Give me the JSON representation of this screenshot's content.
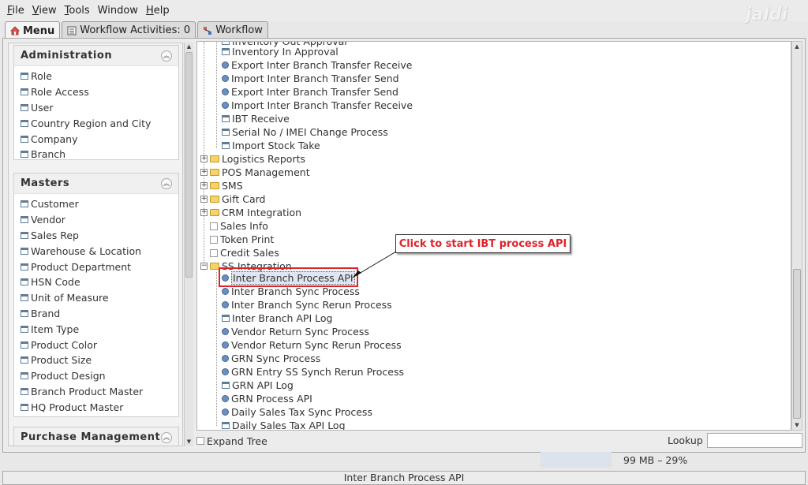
{
  "menubar": {
    "items": [
      {
        "label": "File",
        "mnemonic": "F",
        "rest": "ile"
      },
      {
        "label": "View",
        "mnemonic": "V",
        "rest": "iew"
      },
      {
        "label": "Tools",
        "mnemonic": "T",
        "rest": "ools"
      },
      {
        "label": "Window",
        "mnemonic": "",
        "rest": "Window"
      },
      {
        "label": "Help",
        "mnemonic": "H",
        "rest": "elp"
      }
    ],
    "brand": "jaldi"
  },
  "tabs": [
    {
      "label": "Menu",
      "icon": "home-icon"
    },
    {
      "label": "Workflow Activities: 0",
      "icon": "activities-icon"
    },
    {
      "label": "Workflow",
      "icon": "workflow-icon"
    }
  ],
  "sidebar": {
    "sections": [
      {
        "title": "Administration",
        "items": [
          "Role",
          "Role Access",
          "User",
          "Country Region and City",
          "Company",
          "Branch"
        ]
      },
      {
        "title": "Masters",
        "items": [
          "Customer",
          "Vendor",
          "Sales Rep",
          "Warehouse & Location",
          "Product Department",
          "HSN Code",
          "Unit of Measure",
          "Brand",
          "Item Type",
          "Product Color",
          "Product Size",
          "Product Design",
          "Branch Product Master",
          "HQ Product Master"
        ]
      },
      {
        "title": "Purchase Management",
        "items": []
      }
    ]
  },
  "tree": {
    "nodes": [
      {
        "label": "Inventory Out Approval",
        "icon": "window-icon"
      },
      {
        "label": "Inventory In Approval",
        "icon": "window-icon"
      },
      {
        "label": "Export Inter Branch Transfer Receive",
        "icon": "process-icon"
      },
      {
        "label": "Import Inter Branch Transfer Send",
        "icon": "process-icon"
      },
      {
        "label": "Export Inter Branch Transfer Send",
        "icon": "process-icon"
      },
      {
        "label": "Import Inter Branch Transfer Receive",
        "icon": "process-icon"
      },
      {
        "label": "IBT Receive",
        "icon": "window-icon"
      },
      {
        "label": "Serial No / IMEI Change Process",
        "icon": "window-icon"
      },
      {
        "label": "Import Stock Take",
        "icon": "window-icon"
      },
      {
        "label": "Logistics Reports",
        "icon": "folder-icon"
      },
      {
        "label": "POS Management",
        "icon": "folder-icon"
      },
      {
        "label": "SMS",
        "icon": "folder-icon"
      },
      {
        "label": "Gift Card",
        "icon": "folder-icon"
      },
      {
        "label": "CRM Integration",
        "icon": "folder-icon"
      },
      {
        "label": "Sales Info",
        "icon": "report-icon"
      },
      {
        "label": "Token Print",
        "icon": "report-icon"
      },
      {
        "label": "Credit Sales",
        "icon": "report-icon"
      },
      {
        "label": "SS Integration",
        "icon": "folder-open-icon"
      },
      {
        "label": "Inter Branch Process API",
        "icon": "process-icon"
      },
      {
        "label": "Inter Branch Sync Process",
        "icon": "process-icon"
      },
      {
        "label": "Inter Branch Sync Rerun Process",
        "icon": "process-icon"
      },
      {
        "label": "Inter Branch API Log",
        "icon": "window-icon"
      },
      {
        "label": "Vendor Return Sync Process",
        "icon": "process-icon"
      },
      {
        "label": "Vendor Return Sync Rerun Process",
        "icon": "process-icon"
      },
      {
        "label": "GRN Sync Process",
        "icon": "process-icon"
      },
      {
        "label": "GRN Entry SS Synch Rerun Process",
        "icon": "process-icon"
      },
      {
        "label": "GRN API Log",
        "icon": "window-icon"
      },
      {
        "label": "GRN Process API",
        "icon": "process-icon"
      },
      {
        "label": "Daily Sales Tax Sync Process",
        "icon": "process-icon"
      },
      {
        "label": "Daily Sales Tax API Log",
        "icon": "window-icon"
      }
    ],
    "selected": "Inter Branch Process API"
  },
  "annotation": {
    "callout": "Click to start IBT process API",
    "color": "#e0232b"
  },
  "bottom": {
    "expand_tree": "Expand Tree",
    "lookup": "Lookup",
    "lookup_value": ""
  },
  "memory": {
    "text": "99 MB – 29%"
  },
  "statusbar": {
    "text": "Inter Branch Process API"
  }
}
